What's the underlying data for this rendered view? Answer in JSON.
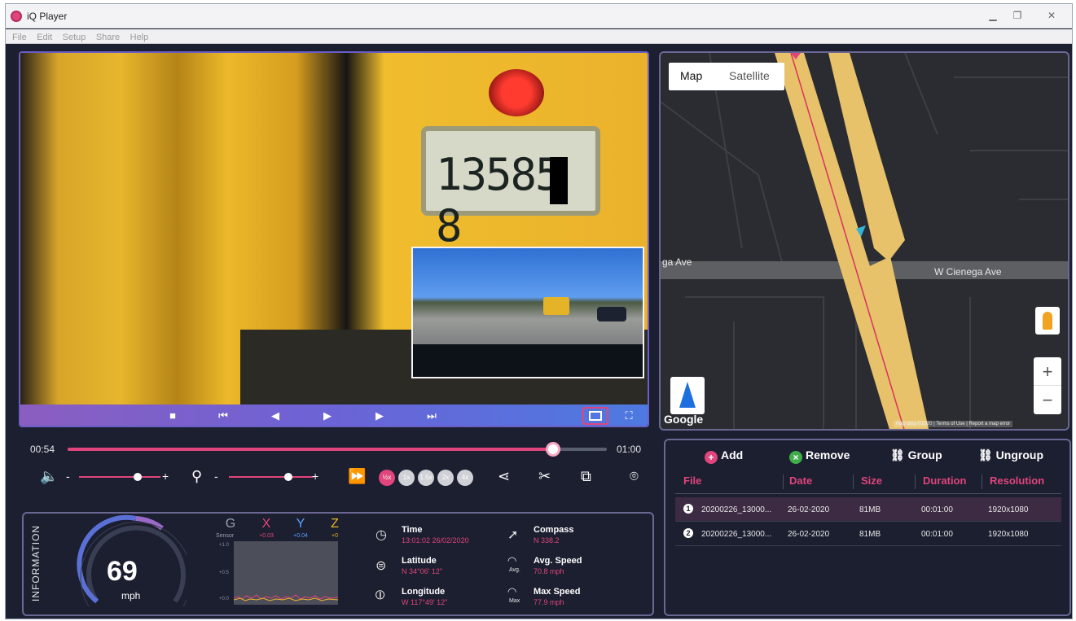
{
  "window": {
    "title": "iQ Player"
  },
  "menu": [
    "File",
    "Edit",
    "Setup",
    "Share",
    "Help"
  ],
  "video": {
    "plate_text": "13585 8"
  },
  "map": {
    "tabs": [
      "Map",
      "Satellite"
    ],
    "road_left_label": "ga Ave",
    "road_right_label": "W Cienega Ave",
    "attribution": "Map data ©2020 | Terms of Use | Report a map error",
    "google_logo": "Google",
    "zoom_in": "+",
    "zoom_out": "−"
  },
  "playback": {
    "current_time": "00:54",
    "end_time": "01:00",
    "progress": 0.9
  },
  "controls": {
    "speeds": [
      "½x",
      "1x",
      "1.5x",
      "2x",
      "4x"
    ],
    "volume_level": 0.72,
    "zoom_level": 0.7,
    "minus": "-",
    "plus": "+"
  },
  "file_actions": {
    "add": "Add",
    "remove": "Remove",
    "group": "Group",
    "ungroup": "Ungroup"
  },
  "file_table": {
    "headers": [
      "File",
      "Date",
      "Size",
      "Duration",
      "Resolution"
    ],
    "rows": [
      {
        "num": "1",
        "file": "20200226_13000...",
        "date": "26-02-2020",
        "size": "81MB",
        "duration": "00:01:00",
        "resolution": "1920x1080"
      },
      {
        "num": "2",
        "file": "20200226_13000...",
        "date": "26-02-2020",
        "size": "81MB",
        "duration": "00:01:00",
        "resolution": "1920x1080"
      }
    ]
  },
  "info": {
    "label": "INFORMATION",
    "speed": "69",
    "speed_unit": "mph",
    "gsensor": {
      "g": "G",
      "sensor": "Sensor",
      "x_label": "X",
      "x_value": "+0.03",
      "y_label": "Y",
      "y_value": "+0.04",
      "z_label": "Z",
      "z_value": "+0",
      "ticks": [
        "+1.0",
        "+0.5",
        "+0.0"
      ]
    },
    "time_label": "Time",
    "time_value": "13:01:02 26/02/2020",
    "latitude_label": "Latitude",
    "latitude_value": "N 34°06' 12\"",
    "longitude_label": "Longitude",
    "longitude_value": "W 117°49' 12\"",
    "compass_label": "Compass",
    "compass_value": "N 338.2",
    "avg_speed_label": "Avg. Speed",
    "avg_speed_value": "70.8 mph",
    "avg_icon_text": "Avg.",
    "max_speed_label": "Max Speed",
    "max_speed_value": "77.9 mph",
    "max_icon_text": "Max"
  },
  "colors": {
    "accent": "#e0457b",
    "background": "#1b1f30",
    "x_axis": "#e0457b",
    "y_axis": "#5aa0ff",
    "z_axis": "#f0b429"
  }
}
